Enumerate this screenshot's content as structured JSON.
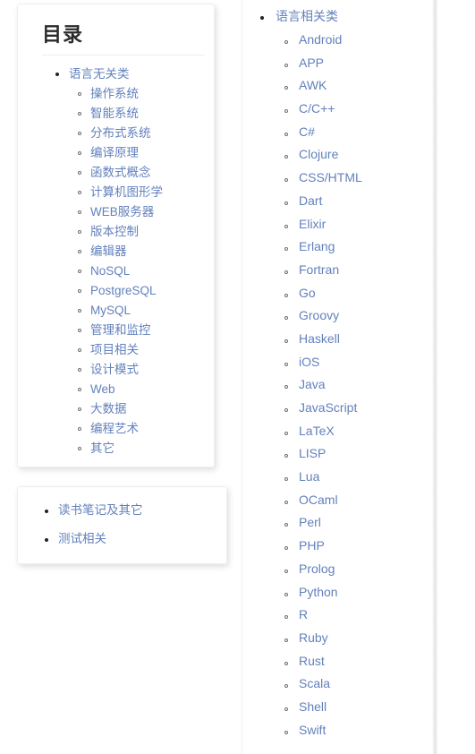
{
  "colors": {
    "link": "#6381bd",
    "heading": "#2b2b2b",
    "card_bg": "#ffffff",
    "divider": "#ededed",
    "page_bg": "#ffffff",
    "bullet_disc": "#222222",
    "bullet_circle": "#6f6f6f"
  },
  "left_column": {
    "toc_card": {
      "title": "目录",
      "sections": [
        {
          "label": "语言无关类",
          "items": [
            "操作系统",
            "智能系统",
            "分布式系统",
            "编译原理",
            "函数式概念",
            "计算机图形学",
            "WEB服务器",
            "版本控制",
            "编辑器",
            "NoSQL",
            "PostgreSQL",
            "MySQL",
            "管理和监控",
            "项目相关",
            "设计模式",
            "Web",
            "大数据",
            "编程艺术",
            "其它"
          ]
        }
      ]
    },
    "misc_card": {
      "items": [
        "读书笔记及其它",
        "测试相关"
      ]
    }
  },
  "right_column": {
    "sections": [
      {
        "label": "语言相关类",
        "items": [
          "Android",
          "APP",
          "AWK",
          "C/C++",
          "C#",
          "Clojure",
          "CSS/HTML",
          "Dart",
          "Elixir",
          "Erlang",
          "Fortran",
          "Go",
          "Groovy",
          "Haskell",
          "iOS",
          "Java",
          "JavaScript",
          "LaTeX",
          "LISP",
          "Lua",
          "OCaml",
          "Perl",
          "PHP",
          "Prolog",
          "Python",
          "R",
          "Ruby",
          "Rust",
          "Scala",
          "Shell",
          "Swift"
        ]
      }
    ]
  }
}
